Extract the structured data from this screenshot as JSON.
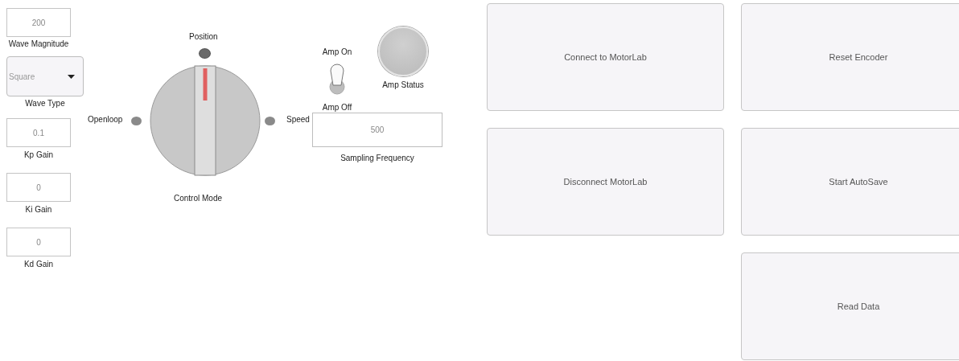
{
  "fields": [
    {
      "kind": "number",
      "value": "200",
      "label": "Wave Magnitude"
    },
    {
      "kind": "dropdown",
      "value": "Square",
      "label": "Wave Type"
    },
    {
      "kind": "number",
      "value": "0.1",
      "label": "Kp Gain"
    },
    {
      "kind": "number",
      "value": "0",
      "label": "Ki Gain"
    },
    {
      "kind": "number",
      "value": "0",
      "label": "Kd Gain"
    }
  ],
  "knob": {
    "label": "Control Mode",
    "options": [
      {
        "label": "Openloop",
        "selected": false
      },
      {
        "label": "Position",
        "selected": true
      },
      {
        "label": "Speed",
        "selected": false
      }
    ]
  },
  "amp_switch": {
    "on_label": "Amp On",
    "off_label": "Amp Off",
    "on": true
  },
  "amp_lamp": {
    "label": "Amp Status",
    "lit": false
  },
  "sampling": {
    "value": "500",
    "label": "Sampling Frequency"
  },
  "button_columns": [
    [
      "Connect to MotorLab",
      "Disconnect MotorLab"
    ],
    [
      "Reset Encoder",
      "Start AutoSave",
      "Read Data"
    ]
  ]
}
